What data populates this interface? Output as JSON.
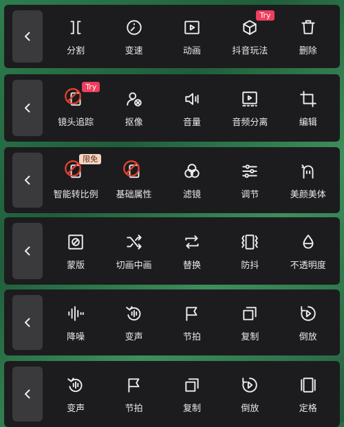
{
  "rows": [
    {
      "items": [
        {
          "label": "分割",
          "icon": "split-icon"
        },
        {
          "label": "变速",
          "icon": "speed-icon"
        },
        {
          "label": "动画",
          "icon": "animation-icon"
        },
        {
          "label": "抖音玩法",
          "icon": "cube-icon",
          "badge": "Try"
        },
        {
          "label": "删除",
          "icon": "delete-icon"
        }
      ]
    },
    {
      "items": [
        {
          "label": "镜头追踪",
          "icon": "blocked-icon",
          "badge": "Try"
        },
        {
          "label": "抠像",
          "icon": "cutout-icon"
        },
        {
          "label": "音量",
          "icon": "volume-icon"
        },
        {
          "label": "音频分离",
          "icon": "audio-split-icon"
        },
        {
          "label": "编辑",
          "icon": "crop-icon"
        }
      ]
    },
    {
      "items": [
        {
          "label": "智能转比例",
          "icon": "blocked-icon",
          "badge": "限免"
        },
        {
          "label": "基础属性",
          "icon": "blocked-icon"
        },
        {
          "label": "滤镜",
          "icon": "filter-icon"
        },
        {
          "label": "调节",
          "icon": "adjust-icon"
        },
        {
          "label": "美颜美体",
          "icon": "beauty-icon"
        }
      ]
    },
    {
      "items": [
        {
          "label": "蒙版",
          "icon": "mask-icon"
        },
        {
          "label": "切画中画",
          "icon": "shuffle-icon"
        },
        {
          "label": "替换",
          "icon": "replace-icon"
        },
        {
          "label": "防抖",
          "icon": "stabilize-icon"
        },
        {
          "label": "不透明度",
          "icon": "opacity-icon"
        }
      ]
    },
    {
      "items": [
        {
          "label": "降噪",
          "icon": "denoise-icon"
        },
        {
          "label": "变声",
          "icon": "voice-change-icon"
        },
        {
          "label": "节拍",
          "icon": "beat-flag-icon"
        },
        {
          "label": "复制",
          "icon": "copy-icon"
        },
        {
          "label": "倒放",
          "icon": "reverse-icon"
        }
      ]
    },
    {
      "items": [
        {
          "label": "变声",
          "icon": "voice-change-icon"
        },
        {
          "label": "节拍",
          "icon": "beat-flag-icon"
        },
        {
          "label": "复制",
          "icon": "copy-icon"
        },
        {
          "label": "倒放",
          "icon": "reverse-icon"
        },
        {
          "label": "定格",
          "icon": "freeze-icon"
        }
      ]
    }
  ],
  "colors": {
    "panel": "#1c1c1e",
    "back": "#3a3a3c",
    "try": "#ef3e5c",
    "free": "#f3d6c2",
    "blocked": "#e8412e"
  }
}
